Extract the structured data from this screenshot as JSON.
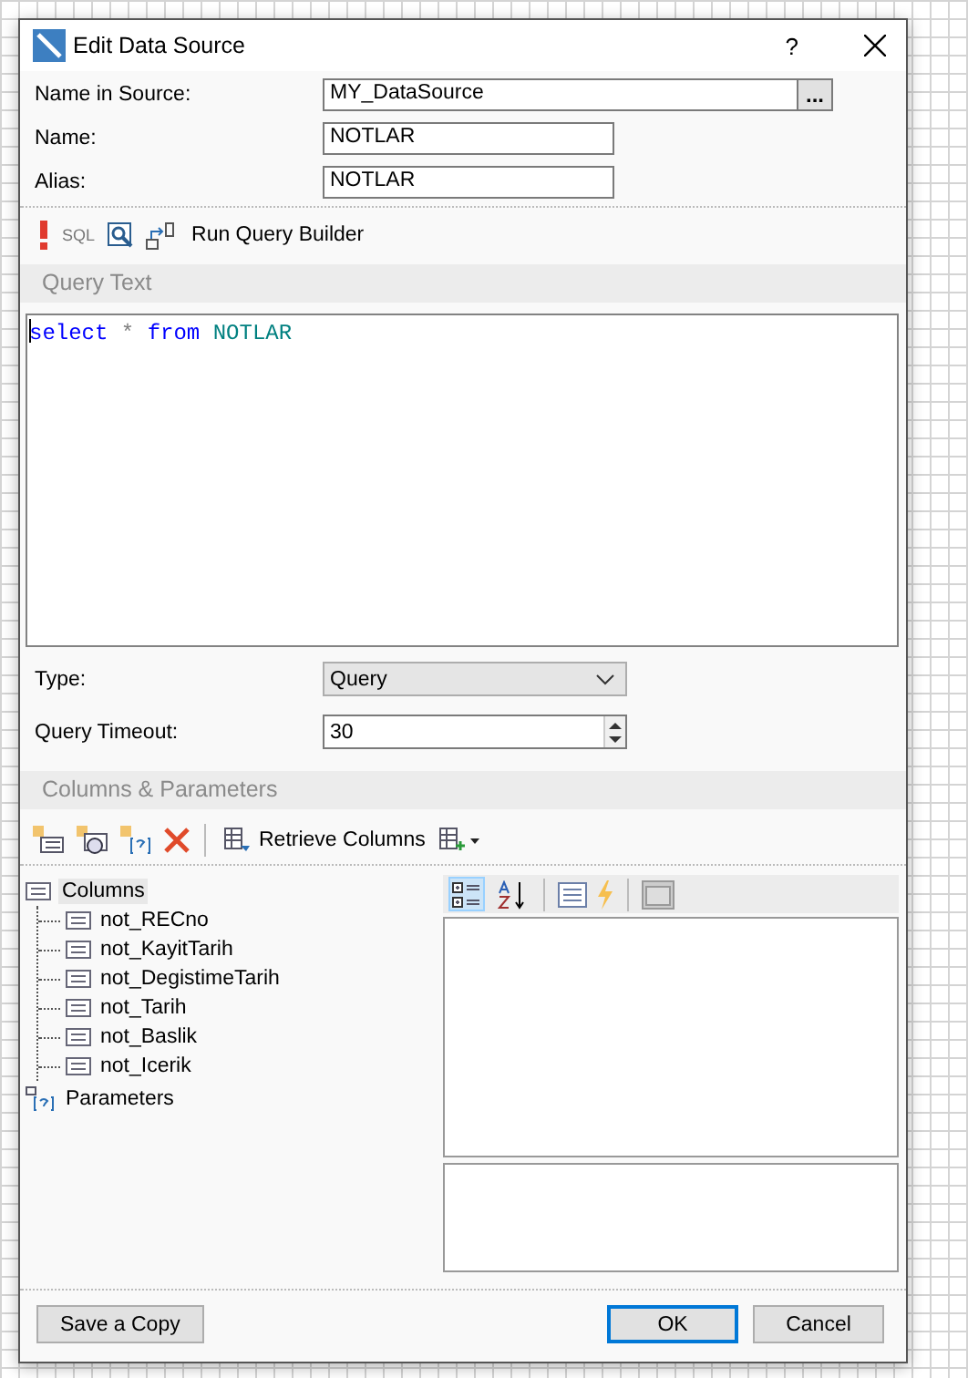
{
  "window": {
    "title": "Edit Data Source",
    "help": "?"
  },
  "fields": [
    {
      "label": "Name in Source:",
      "value": "MY_DataSource",
      "kind": "browse",
      "browse": "..."
    },
    {
      "label": "Name:",
      "value": "NOTLAR",
      "kind": "text"
    },
    {
      "label": "Alias:",
      "value": "NOTLAR",
      "kind": "text"
    }
  ],
  "query_toolbar": {
    "sql": "SQL",
    "run_query_builder": "Run Query Builder"
  },
  "query_text": {
    "header": "Query Text",
    "code": [
      {
        "text": "select",
        "kind": "keyword"
      },
      {
        "text": "*",
        "kind": "operator"
      },
      {
        "text": "from",
        "kind": "keyword"
      },
      {
        "text": "NOTLAR",
        "kind": "identifier"
      }
    ]
  },
  "options": [
    {
      "label": "Type:",
      "value": "Query",
      "kind": "select"
    },
    {
      "label": "Query Timeout:",
      "value": "30",
      "kind": "spin"
    }
  ],
  "columns_section": {
    "header": "Columns & Parameters",
    "retrieve": "Retrieve Columns",
    "tree": [
      {
        "label": "Columns",
        "kind": "columns",
        "selected": true,
        "children": [
          {
            "label": "not_RECno"
          },
          {
            "label": "not_KayitTarih"
          },
          {
            "label": "not_DegistimeTarih"
          },
          {
            "label": "not_Tarih"
          },
          {
            "label": "not_Baslik"
          },
          {
            "label": "not_Icerik"
          }
        ]
      },
      {
        "label": "Parameters",
        "kind": "parameters",
        "selected": false
      }
    ],
    "sort_modes": [
      {
        "kind": "categorized",
        "selected": true
      },
      {
        "kind": "alphabetical",
        "selected": false
      }
    ]
  },
  "buttons": [
    {
      "label": "Save a Copy",
      "default": false
    },
    {
      "label": "OK",
      "default": true
    },
    {
      "label": "Cancel",
      "default": false
    }
  ]
}
